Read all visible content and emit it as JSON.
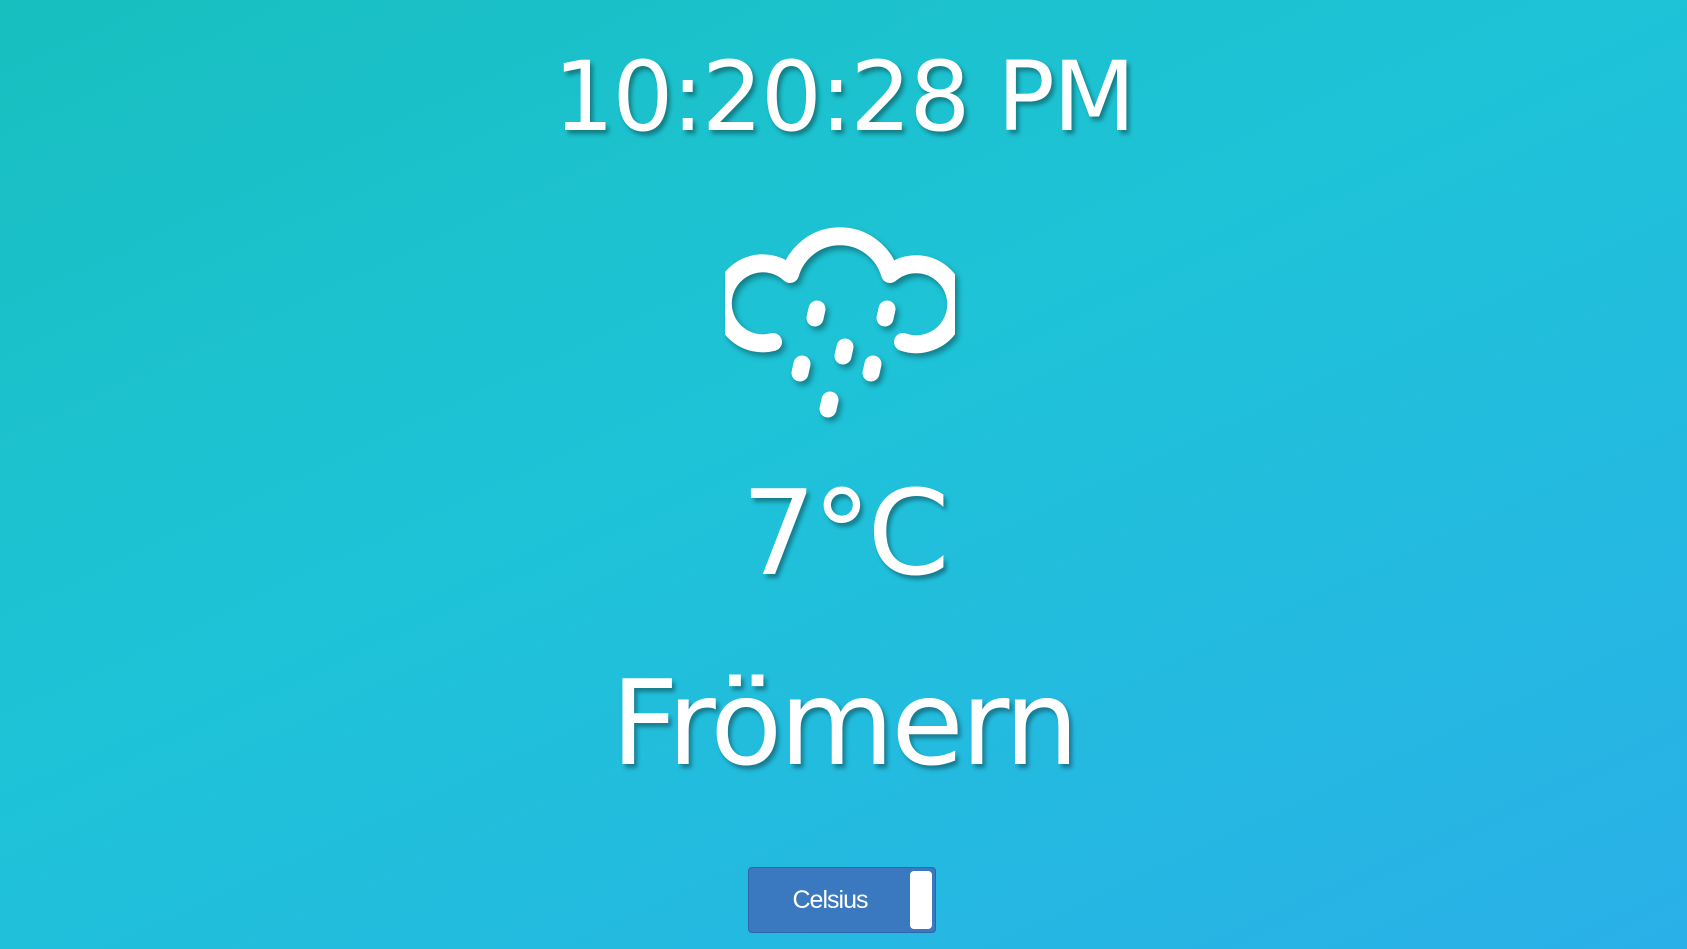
{
  "clock": {
    "time": "10:20:28 PM"
  },
  "weather": {
    "icon": "rain-cloud-icon",
    "temperature": "7°C",
    "location": "Frömern"
  },
  "unit_toggle": {
    "label": "Celsius"
  },
  "colors": {
    "background_start": "#18bfbf",
    "background_end": "#2ab0e8",
    "toggle_bg": "#3a78bf",
    "text": "#ffffff"
  }
}
